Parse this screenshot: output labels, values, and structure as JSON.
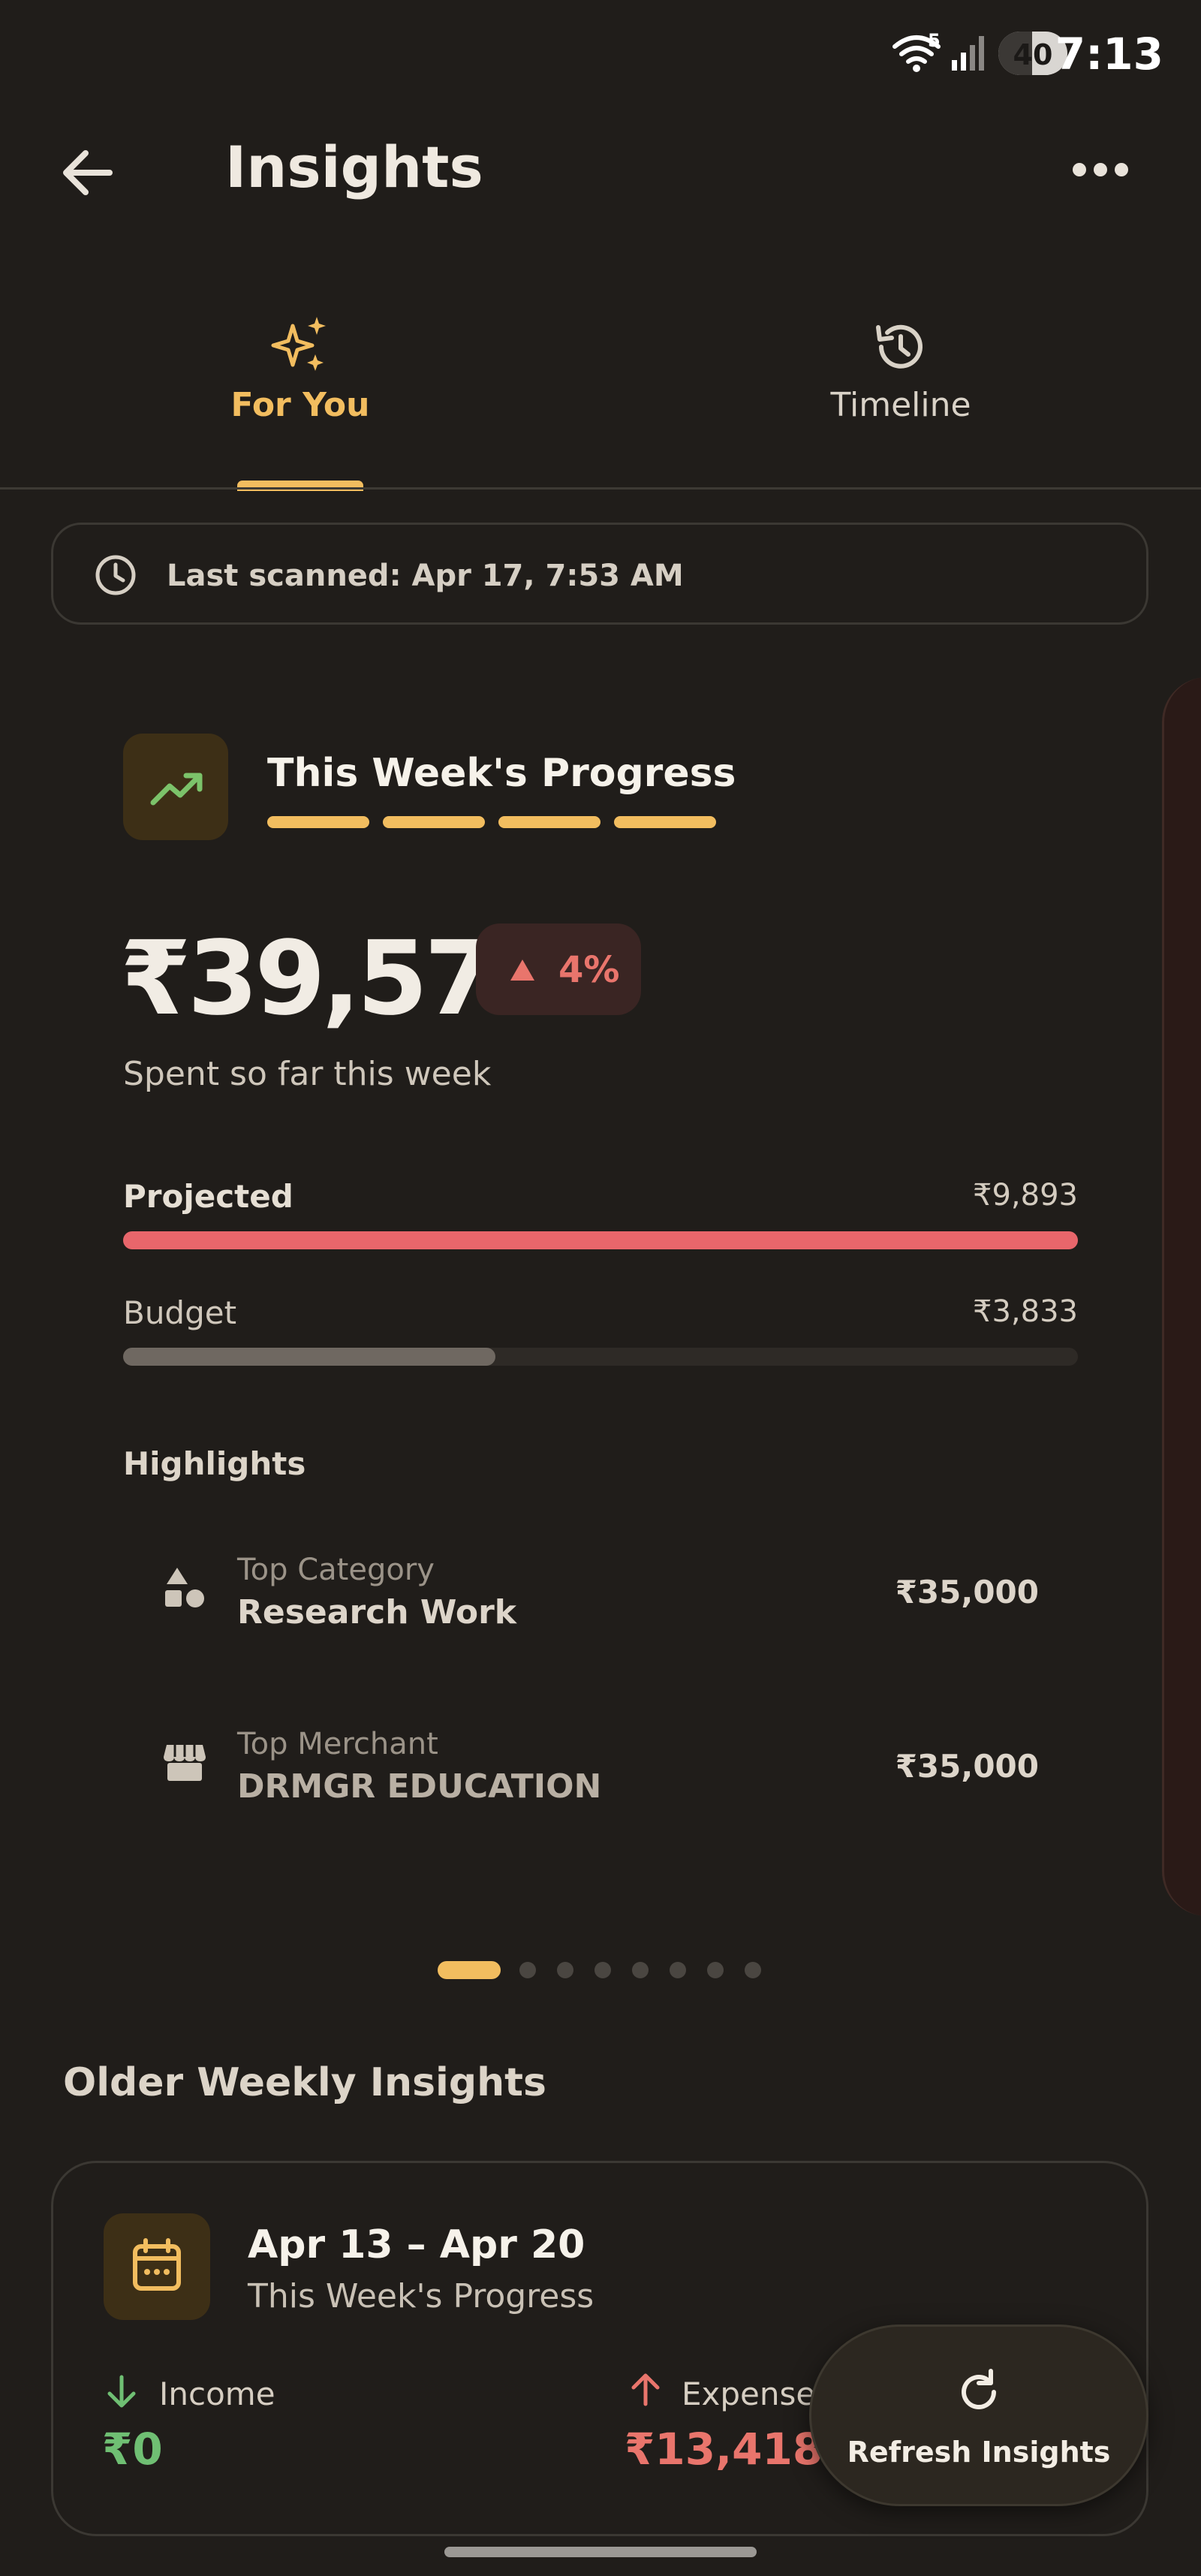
{
  "status_bar": {
    "time": "7:13",
    "battery": "40",
    "wifi_badge": "5"
  },
  "app_bar": {
    "title": "Insights",
    "back_icon": "arrow-left-icon",
    "menu_icon": "more-horizontal-icon"
  },
  "tabs": [
    {
      "label": "For You",
      "icon": "sparkles-icon",
      "active": true
    },
    {
      "label": "Timeline",
      "icon": "history-icon",
      "active": false
    }
  ],
  "scan": {
    "text": "Last scanned: Apr 17, 7:53 AM",
    "icon": "clock-icon"
  },
  "progress_card": {
    "title": "This Week's Progress",
    "icon": "trending-up-icon",
    "amount": "₹39,571",
    "change": "4%",
    "change_direction": "up",
    "subtitle": "Spent so far this week",
    "projected": {
      "label": "Projected",
      "value": "₹9,893",
      "fill_fraction": 1.0
    },
    "budget": {
      "label": "Budget",
      "value": "₹3,833",
      "fill_fraction": 0.39
    },
    "highlights_title": "Highlights",
    "highlights": [
      {
        "category": "Top Category",
        "name": "Research Work",
        "amount": "₹35,000",
        "icon": "shapes-icon"
      },
      {
        "category": "Top Merchant",
        "name": "DRMGR EDUCATION",
        "amount": "₹35,000",
        "icon": "store-icon"
      }
    ]
  },
  "pager": {
    "count": 8,
    "active_index": 0
  },
  "older": {
    "title": "Older Weekly Insights",
    "card": {
      "range": "Apr 13 – Apr 20",
      "subtitle": "This Week's Progress",
      "icon": "calendar-icon",
      "income_label": "Income",
      "income_value": "₹0",
      "expense_label": "Expense",
      "expense_value": "₹13,418"
    }
  },
  "fab": {
    "label": "Refresh Insights",
    "icon": "refresh-icon"
  },
  "colors": {
    "accent": "#f2bd5f",
    "negative": "#e9756c",
    "positive": "#6fbf73",
    "background": "#201d1a"
  }
}
